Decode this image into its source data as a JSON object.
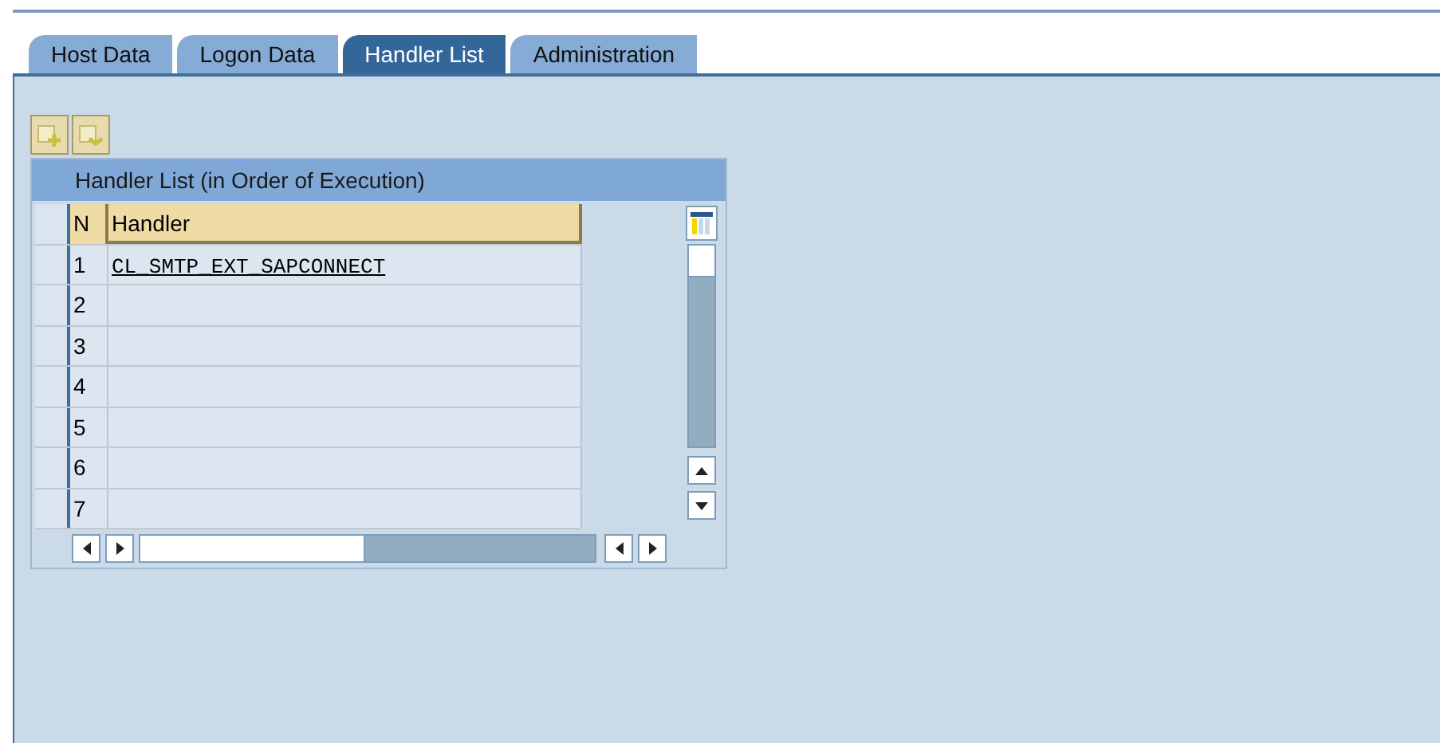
{
  "tabs": [
    {
      "label": "Host Data",
      "selected": false
    },
    {
      "label": "Logon Data",
      "selected": false
    },
    {
      "label": "Handler List",
      "selected": true
    },
    {
      "label": "Administration",
      "selected": false
    }
  ],
  "table": {
    "title": "Handler List (in Order of Execution)",
    "columns": [
      "N",
      "Handler"
    ],
    "rows": [
      {
        "n": "1",
        "handler": "CL_SMTP_EXT_SAPCONNECT"
      },
      {
        "n": "2"
      },
      {
        "n": "3"
      },
      {
        "n": "4"
      },
      {
        "n": "5"
      },
      {
        "n": "6"
      },
      {
        "n": "7"
      }
    ]
  }
}
